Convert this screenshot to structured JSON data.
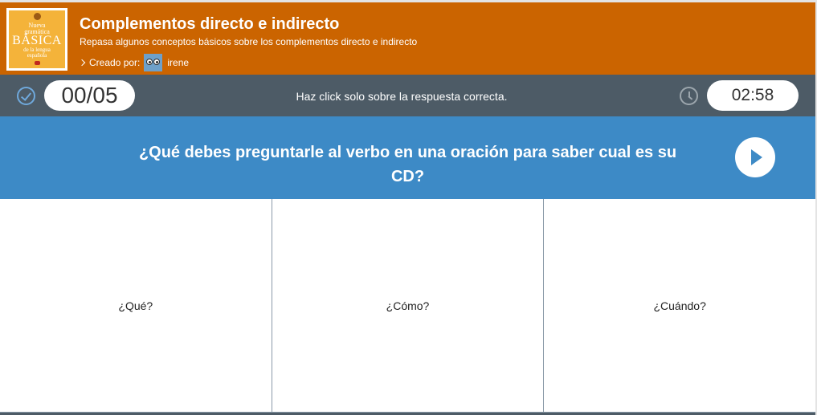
{
  "header": {
    "title": "Complementos directo e indirecto",
    "subtitle": "Repasa algunos conceptos básicos sobre los complementos directo e indirecto",
    "creator_label": "Creado por:",
    "creator_name": "irene",
    "cover": {
      "line1": "Nueva",
      "line2": "gramática",
      "line3": "BÁSICA",
      "line4": "de la lengua",
      "line5": "española"
    }
  },
  "status": {
    "score": "00/05",
    "instruction": "Haz click solo sobre la respuesta correcta.",
    "timer": "02:58"
  },
  "question": {
    "text": "¿Qué debes preguntarle al verbo en una oración para saber cual es su CD?"
  },
  "answers": [
    {
      "label": "¿Qué?"
    },
    {
      "label": "¿Cómo?"
    },
    {
      "label": "¿Cuándo?"
    }
  ],
  "colors": {
    "header_bg": "#cb6400",
    "statusbar_bg": "#4d5b66",
    "question_bg": "#3d8ac6",
    "cover_bg": "#f4b33a"
  },
  "icons": {
    "score": "check-circle-icon",
    "timer": "clock-icon",
    "next": "play-icon",
    "creator_prefix": "chevron-right-icon"
  }
}
